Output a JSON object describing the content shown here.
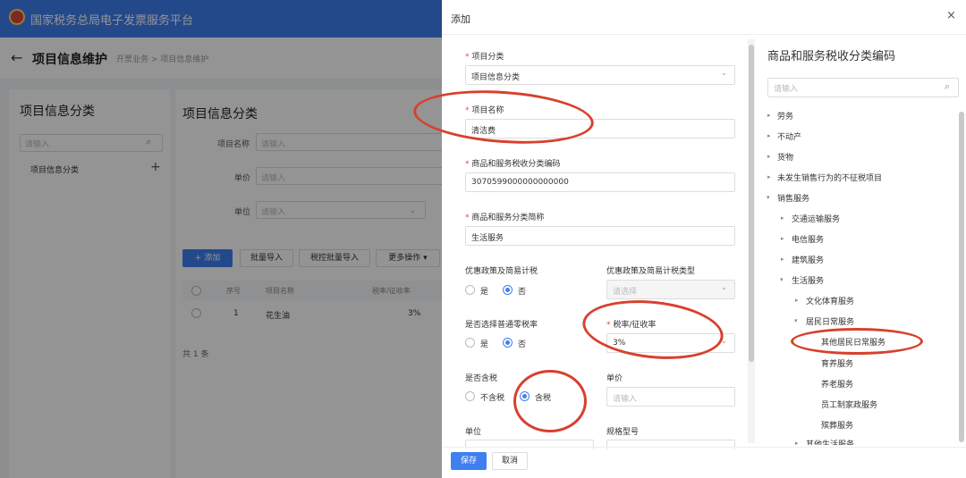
{
  "app": {
    "title": "国家税务总局电子发票服务平台"
  },
  "header": {
    "page_title": "项目信息维护",
    "breadcrumb": "开票业务 > 项目信息维护"
  },
  "left_panel": {
    "title": "项目信息分类",
    "search_placeholder": "请输入",
    "item": "项目信息分类"
  },
  "main": {
    "title": "项目信息分类",
    "filters": [
      {
        "label": "项目名称",
        "placeholder": "请输入"
      },
      {
        "label": "单价",
        "placeholder": "请输入"
      },
      {
        "label": "单位",
        "placeholder": "请输入"
      }
    ],
    "buttons": {
      "add": "+ 添加",
      "batch_import": "批量导入",
      "tax_batch_import": "税控批量导入",
      "more": "更多操作 ▾"
    },
    "table": {
      "headers": [
        "序号",
        "项目名称",
        "税率/征收率"
      ],
      "rows": [
        {
          "index": "1",
          "name": "花生油",
          "rate": "3%"
        }
      ],
      "total": "共 1 条"
    }
  },
  "dialog": {
    "title": "添加",
    "close_icon": "close-icon",
    "fields": {
      "category_label": "项目分类",
      "category_value": "项目信息分类",
      "name_label": "项目名称",
      "name_value": "清洁费",
      "code_label": "商品和服务税收分类编码",
      "code_value": "3070599000000000000",
      "short_label": "商品和服务分类简称",
      "short_value": "生活服务",
      "preferential_label": "优惠政策及简易计税",
      "preferential_yes": "是",
      "preferential_no": "否",
      "preferential_type_label": "优惠政策及简易计税类型",
      "preferential_type_placeholder": "请选择",
      "zero_rate_label": "是否选择普通零税率",
      "zero_yes": "是",
      "zero_no": "否",
      "rate_label": "税率/征收率",
      "rate_value": "3%",
      "tax_included_label": "是否含税",
      "tax_excluded_option": "不含税",
      "tax_included_option": "含税",
      "unit_price_label": "单价",
      "unit_price_placeholder": "请输入",
      "unit_label": "单位",
      "spec_label": "规格型号"
    },
    "footer": {
      "save": "保存",
      "cancel": "取消"
    }
  },
  "tree": {
    "title": "商品和服务税收分类编码",
    "search_placeholder": "请输入",
    "items": [
      {
        "label": "劳务"
      },
      {
        "label": "不动产"
      },
      {
        "label": "货物"
      },
      {
        "label": "未发生销售行为的不征税项目"
      },
      {
        "label": "销售服务"
      },
      {
        "label": "交通运输服务"
      },
      {
        "label": "电信服务"
      },
      {
        "label": "建筑服务"
      },
      {
        "label": "生活服务"
      },
      {
        "label": "文化体育服务"
      },
      {
        "label": "居民日常服务"
      },
      {
        "label": "其他居民日常服务"
      },
      {
        "label": "育养服务"
      },
      {
        "label": "养老服务"
      },
      {
        "label": "员工制家政服务"
      },
      {
        "label": "殡葬服务"
      },
      {
        "label": "其他生活服务"
      }
    ]
  },
  "colors": {
    "primary": "#3f7ff0",
    "annotation": "#d8402d"
  }
}
